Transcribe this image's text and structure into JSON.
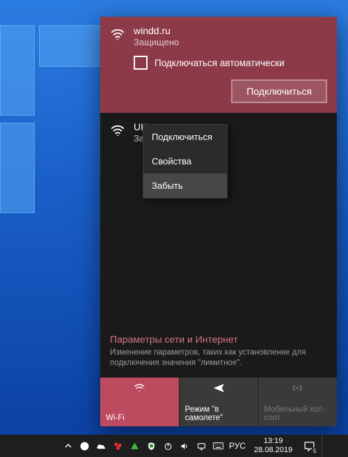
{
  "network_flyout": {
    "selected_network": {
      "name": "windd.ru",
      "status": "Защищено",
      "auto_connect_label": "Подключаться автоматически",
      "connect_button": "Подключиться"
    },
    "other_network": {
      "name": "UKm",
      "status": "Защищено"
    },
    "context_menu": {
      "connect": "Подключиться",
      "properties": "Свойства",
      "forget": "Забыть"
    },
    "settings": {
      "title": "Параметры сети и Интернет",
      "description": "Изменение параметров, таких как установление для подключения значения \"лимитное\"."
    },
    "tiles": {
      "wifi": "Wi-Fi",
      "airplane": "Режим \"в самолете\"",
      "hotspot": "Мобильный хот-спот"
    }
  },
  "taskbar": {
    "lang": "РУС",
    "time": "13:19",
    "date": "28.08.2019",
    "notif_count": "5"
  }
}
